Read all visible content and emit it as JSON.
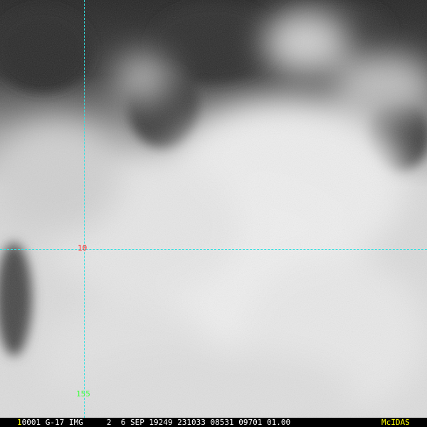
{
  "image": {
    "subject": "satellite-imagery",
    "colors": {
      "background_ocean": "#2a2a2a",
      "cloud_bright": "#ececec",
      "gridline": "#33e0e0",
      "lat_label": "#ff2a2a",
      "lon_label": "#40ff40",
      "status_text": "#ffffff",
      "status_highlight": "#ffff00"
    }
  },
  "grid": {
    "latitude_label": "10",
    "longitude_label": "155"
  },
  "status_bar": {
    "frame_number": "1",
    "info_text": "0001 G-17 IMG     2  6 SEP 19249 231033 08531 09701 01.00",
    "brand": "McIDAS"
  }
}
